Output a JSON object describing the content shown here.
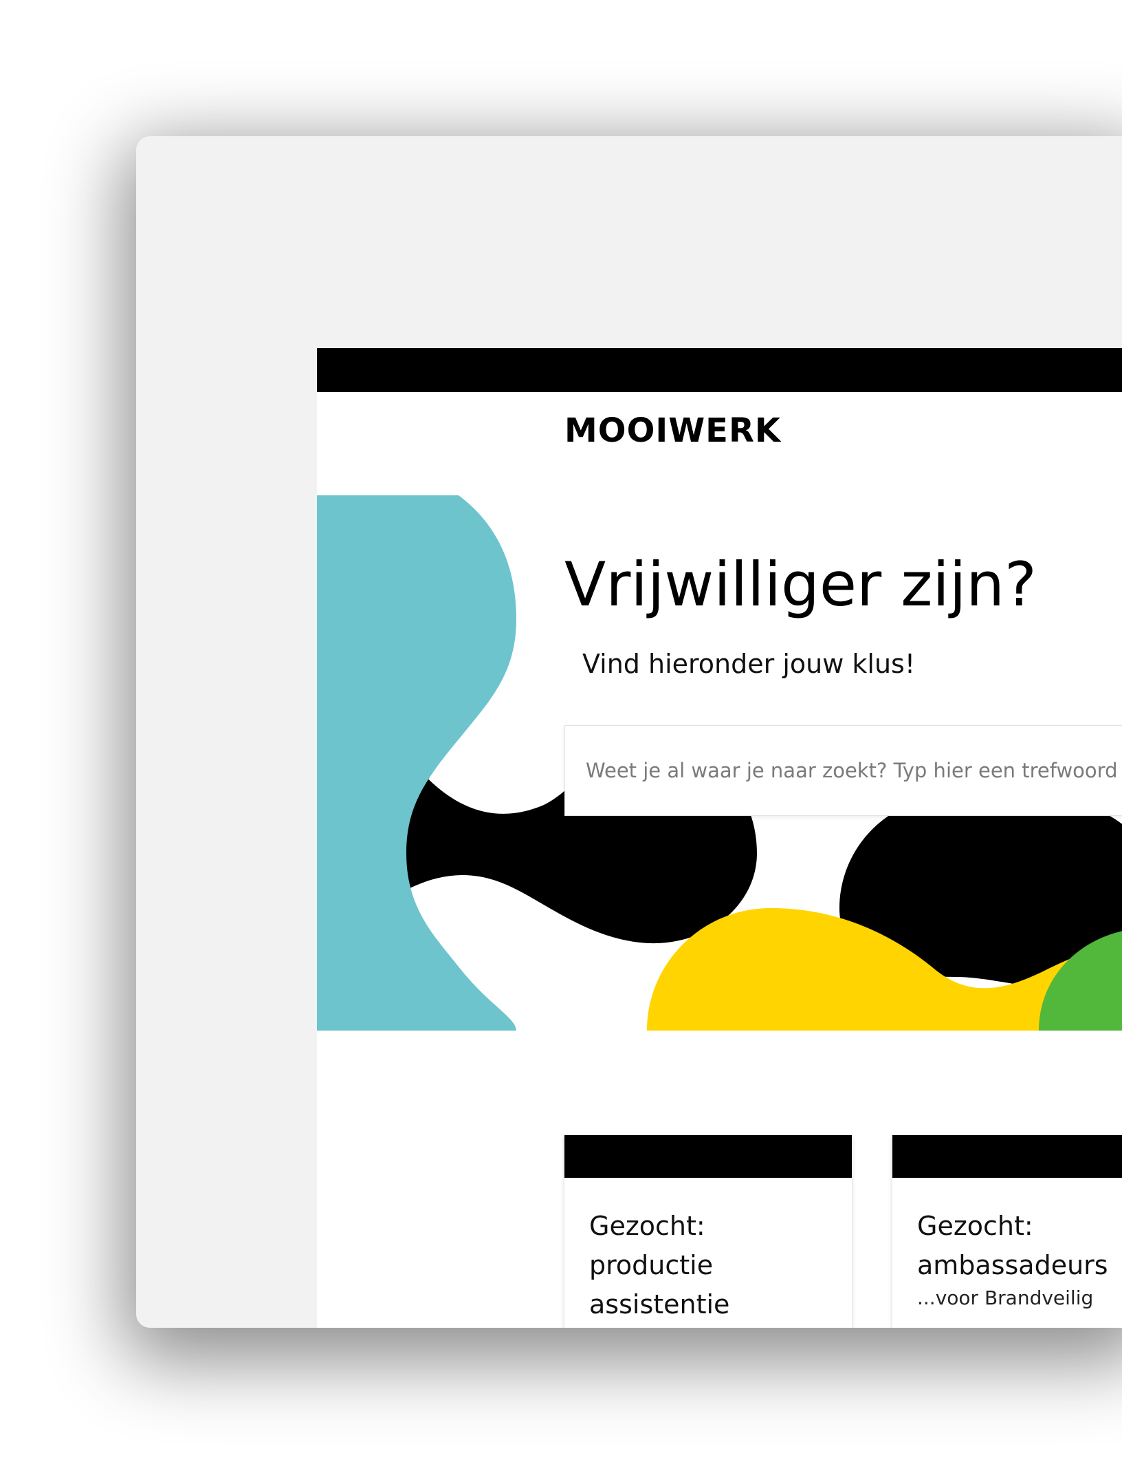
{
  "site": {
    "logo_text": "MOOIWERK"
  },
  "hero": {
    "title": "Vrijwilliger zijn?",
    "subtitle": "Vind hieronder jouw klus!",
    "colors": {
      "teal": "#6DC4CD",
      "black": "#000000",
      "yellow": "#FFD400",
      "green": "#52B83B"
    }
  },
  "search": {
    "placeholder": "Weet je al waar je naar zoekt? Typ hier een trefwoord in",
    "value": ""
  },
  "cards": [
    {
      "title": "Gezocht:\nproductie\nassistentie",
      "snippet": ""
    },
    {
      "title": "Gezocht:\nambassadeurs",
      "snippet": "...voor Brandveilig"
    }
  ]
}
